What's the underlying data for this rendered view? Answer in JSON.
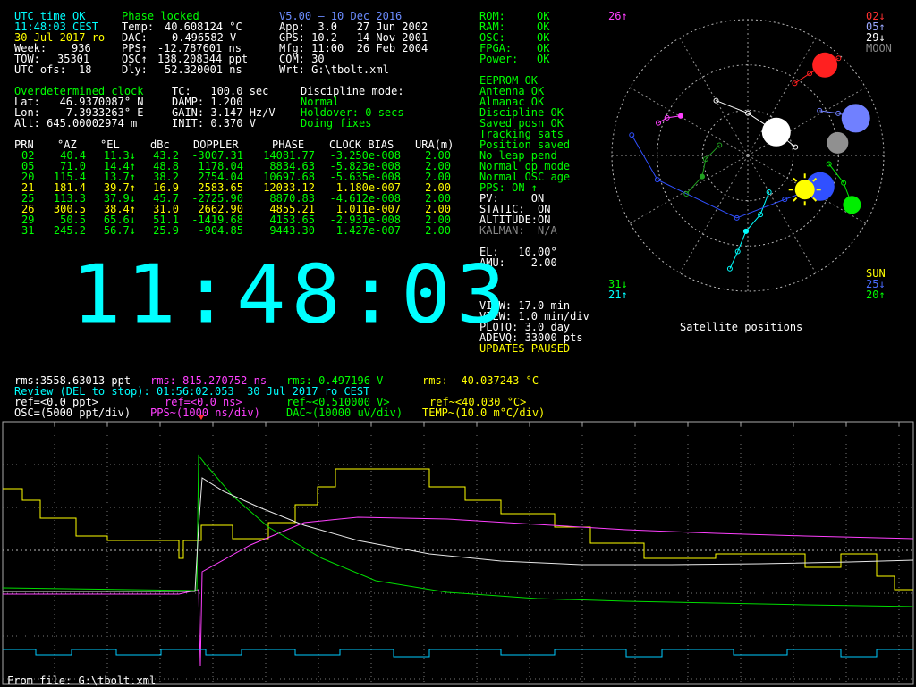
{
  "status": {
    "utc_time_ok": "UTC time OK",
    "phase_locked": "Phase locked",
    "time": "11:48:03 CEST",
    "date": "30 Jul 2017 ro",
    "week_label": "Week:",
    "week": "936",
    "tow_label": "TOW:",
    "tow": "35301",
    "utcofs_label": "UTC ofs:",
    "utcofs": "18"
  },
  "measure": {
    "temp_label": "Temp:",
    "temp": "40.608124 °C",
    "dac_label": "DAC:",
    "dac": "0.496582 V",
    "pps_label": "PPS↑",
    "pps": "-12.787601 ns",
    "osc_label": "OSC↑",
    "osc": "138.208344 ppt",
    "dly_label": "Dly:",
    "dly": "52.320001 ns"
  },
  "version": {
    "title": "V5.00 — 10 Dec 2016",
    "app": "App:  3.0   27 Jun 2002",
    "gps": "GPS: 10.2   14 Nov 2001",
    "mfg": "Mfg: 11:00  26 Feb 2004",
    "com": "COM: 30",
    "wrt": "Wrt: G:\\tbolt.xml"
  },
  "health": [
    {
      "label": "ROM:",
      "value": "OK"
    },
    {
      "label": "RAM:",
      "value": "OK"
    },
    {
      "label": "OSC:",
      "value": "OK"
    },
    {
      "label": "FPGA:",
      "value": "OK"
    },
    {
      "label": "Power:",
      "value": "OK"
    }
  ],
  "status2": [
    "EEPROM OK",
    "Antenna OK",
    "Almanac OK",
    "Discipline OK",
    "Saved posn OK",
    "Tracking sats",
    "Position saved",
    "No leap pend",
    "Normal op mode",
    "Normal OSC age",
    "PPS: ON ↑"
  ],
  "modes": {
    "pv": "PV:     ON",
    "static": "STATIC:  ON",
    "altitude": "ALTITUDE:ON",
    "kalman": "KALMAN:  N/A",
    "el": "EL:   10.00°",
    "amu": "AMU:    2.00"
  },
  "view": {
    "view1": "VIEW: 17.0 min",
    "view2": "VIEW: 1.0 min/div",
    "plotq": "PLOTQ: 3.0 day",
    "adevq": "ADEVQ: 33000 pts",
    "paused": "UPDATES PAUSED"
  },
  "clock": {
    "overdet": "Overdetermined clock",
    "lat": "Lat:   46.9370087° N",
    "lon": "Lon:    7.3933263° E",
    "alt": "Alt: 645.00002974 m",
    "tc": "TC:   100.0 sec",
    "damp": "DAMP: 1.200",
    "gain": "GAIN:-3.147 Hz/V",
    "init": "INIT: 0.370 V",
    "disc_label": "Discipline mode:",
    "disc_normal": "Normal",
    "disc_holdover": "Holdover: 0 secs",
    "disc_fixes": "Doing fixes"
  },
  "sat_table": {
    "headers": [
      "PRN",
      "°AZ",
      "°EL",
      "dBc",
      "DOPPLER",
      "PHASE",
      "CLOCK BIAS",
      "URA(m)"
    ],
    "rows": [
      {
        "prn": "02",
        "az": "40.4",
        "el": "11.3↓",
        "dbc": "43.2",
        "doppler": "-3007.31",
        "phase": "14081.77",
        "bias": "-3.250e-008",
        "ura": "2.00",
        "color": "#00ff00"
      },
      {
        "prn": "05",
        "az": "71.0",
        "el": "14.4↑",
        "dbc": "48.8",
        "doppler": "1178.04",
        "phase": "8834.63",
        "bias": "-5.823e-008",
        "ura": "2.00",
        "color": "#00ff00"
      },
      {
        "prn": "20",
        "az": "115.4",
        "el": "13.7↑",
        "dbc": "38.2",
        "doppler": "2754.04",
        "phase": "10697.68",
        "bias": "-5.635e-008",
        "ura": "2.00",
        "color": "#00ff00"
      },
      {
        "prn": "21",
        "az": "181.4",
        "el": "39.7↑",
        "dbc": "16.9",
        "doppler": "2583.65",
        "phase": "12033.12",
        "bias": "1.180e-007",
        "ura": "2.00",
        "color": "#ffff00"
      },
      {
        "prn": "25",
        "az": "113.3",
        "el": "37.9↓",
        "dbc": "45.7",
        "doppler": "-2725.90",
        "phase": "8870.83",
        "bias": "-4.612e-008",
        "ura": "2.00",
        "color": "#00ff00"
      },
      {
        "prn": "26",
        "az": "300.5",
        "el": "38.4↑",
        "dbc": "31.0",
        "doppler": "2662.90",
        "phase": "4855.21",
        "bias": "1.011e-007",
        "ura": "2.00",
        "color": "#ffff00"
      },
      {
        "prn": "29",
        "az": "50.5",
        "el": "65.6↓",
        "dbc": "51.1",
        "doppler": "-1419.68",
        "phase": "4153.65",
        "bias": "-2.931e-008",
        "ura": "2.00",
        "color": "#00ff00"
      },
      {
        "prn": "31",
        "az": "245.2",
        "el": "56.7↓",
        "dbc": "25.9",
        "doppler": "-904.85",
        "phase": "9443.30",
        "bias": "1.427e-007",
        "ura": "2.00",
        "color": "#00ff00"
      }
    ]
  },
  "big_clock": "11:48:03",
  "sky": {
    "caption": "Satellite positions",
    "labels": {
      "s26": "26↑",
      "s02": "02↓",
      "s05": "05↑",
      "s29": "29↓",
      "moon": "MOON",
      "s31": "31↓",
      "s21": "21↑",
      "sun": "SUN",
      "s25": "25↓",
      "s20": "20↑"
    },
    "satellites": [
      {
        "prn": "02",
        "az": 40.4,
        "el": 11.3,
        "color": "#ff2020"
      },
      {
        "prn": "05",
        "az": 71.0,
        "el": 14.4,
        "color": "#7080ff"
      },
      {
        "prn": "20",
        "az": 115.4,
        "el": 13.7,
        "color": "#00ee00"
      },
      {
        "prn": "21",
        "az": 181.4,
        "el": 39.7,
        "color": "#00ffff"
      },
      {
        "prn": "25",
        "az": 113.3,
        "el": 37.9,
        "color": "#3050ff"
      },
      {
        "prn": "26",
        "az": 300.5,
        "el": 38.4,
        "color": "#ff40ff"
      },
      {
        "prn": "29",
        "az": 50.5,
        "el": 65.6,
        "color": "#ffffff"
      },
      {
        "prn": "31",
        "az": 245.2,
        "el": 56.7,
        "color": "#20a020"
      }
    ],
    "sun": {
      "az": 121.0,
      "el": 46.0,
      "color": "#ffff00"
    },
    "moon": {
      "az": 82.0,
      "el": 30.0,
      "color": "#909090"
    }
  },
  "rms": {
    "osc": "rms:3558.63013 ppt",
    "pps": "rms: 815.270752 ns",
    "dac": "rms: 0.497196 V",
    "temp": "rms:  40.037243 °C"
  },
  "review": "Review (DEL to stop): 01:56:02.053  30 Jul 2017 ro CEST",
  "refs": {
    "osc": "ref=<0.0 ppt>",
    "pps": "ref=<0.0 ns>",
    "dac": "ref~<0.510000 V>",
    "temp": "ref~<40.030 °C>"
  },
  "scales": {
    "osc": "OSC=(5000 ppt/div)",
    "pps": "PPS~(1000 ns/div)",
    "dac": "DAC~(10000 uV/div)",
    "temp": "TEMP~(10.0 m°C/div)"
  },
  "from_file": "From file: G:\\tbolt.xml"
}
